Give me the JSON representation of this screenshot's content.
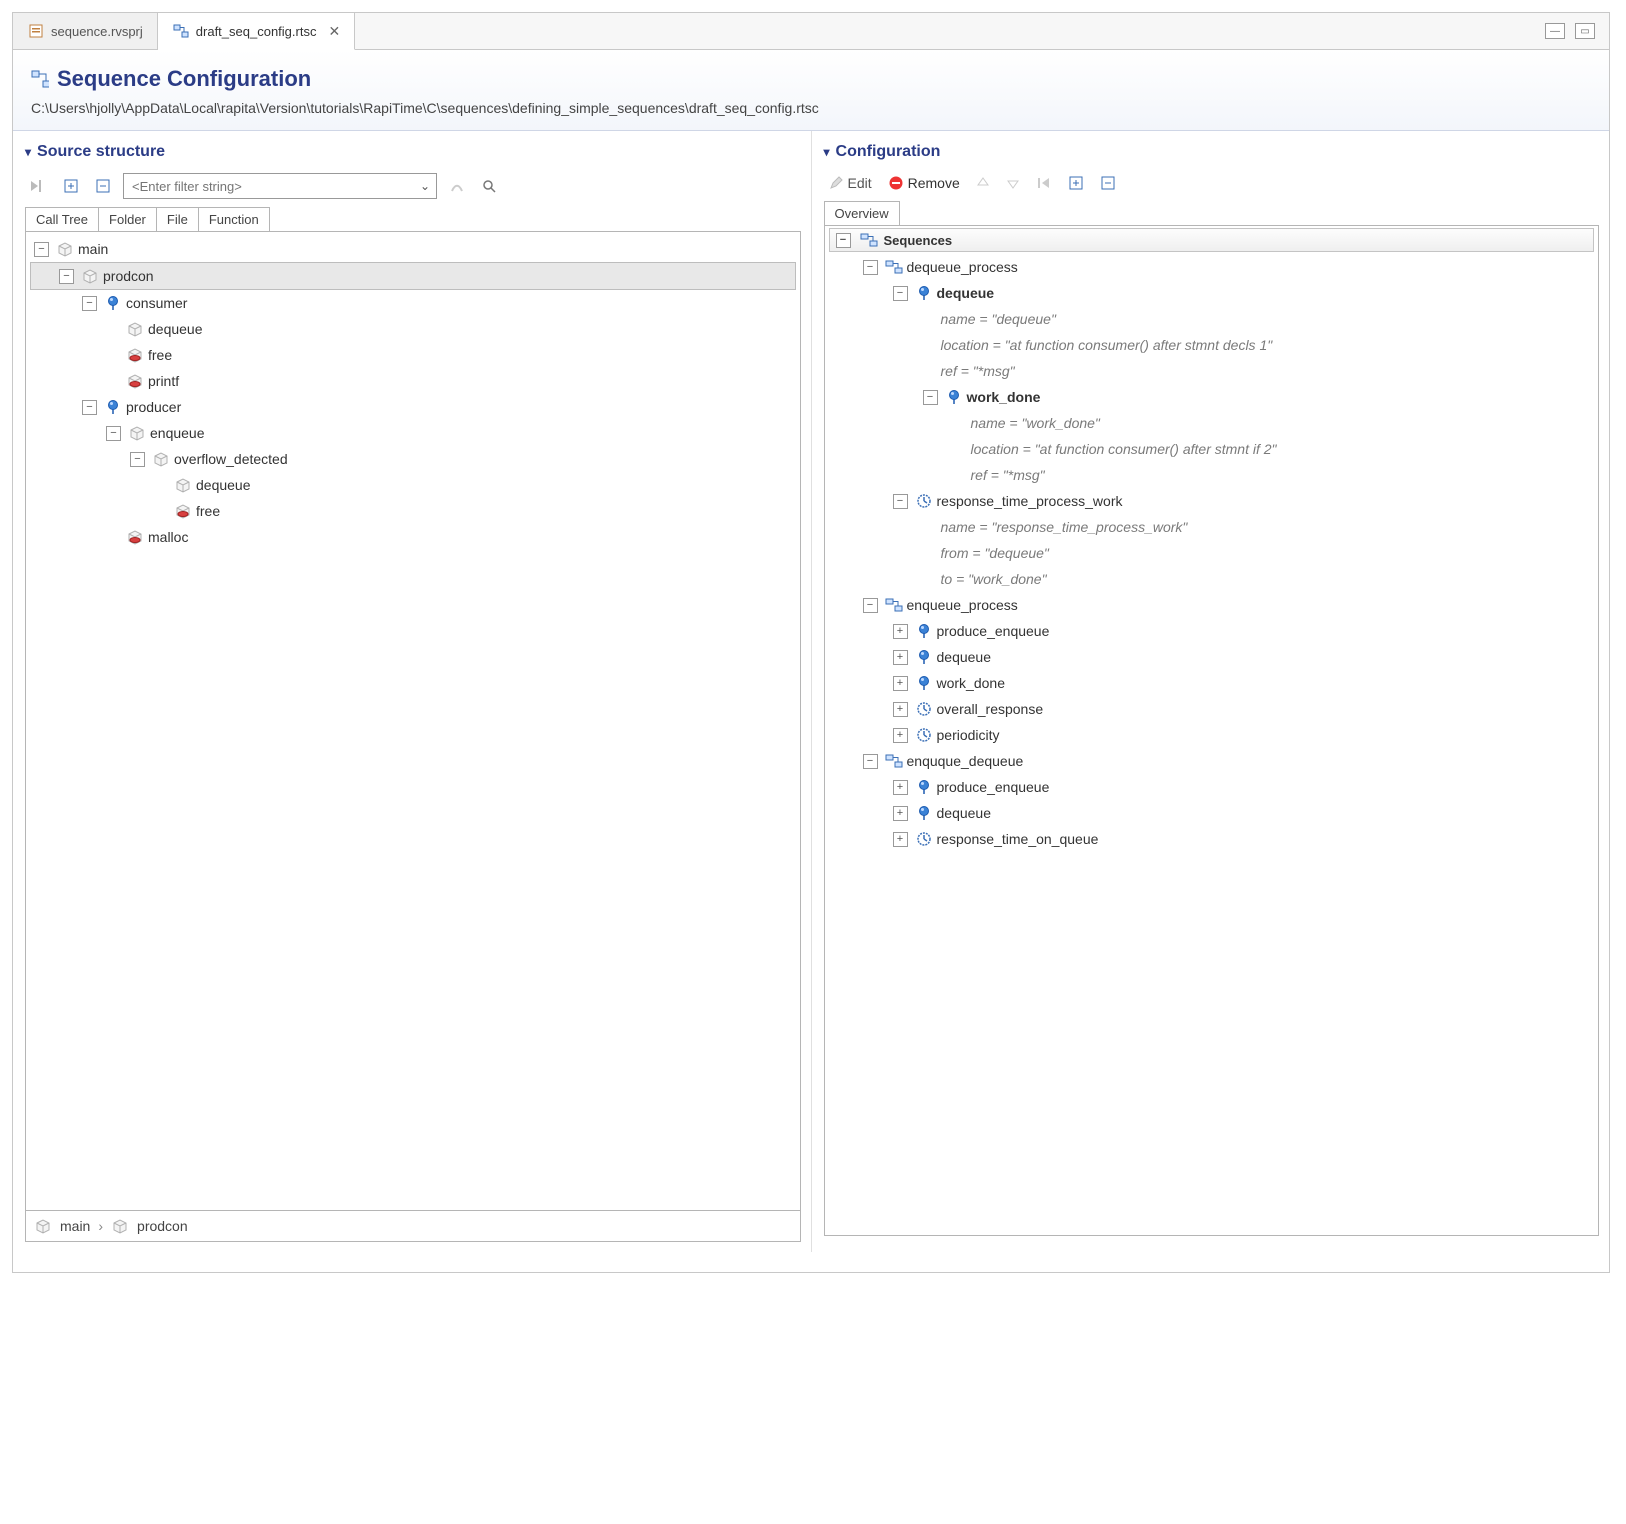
{
  "tabs": [
    {
      "label": "sequence.rvsprj",
      "icon": "file-project"
    },
    {
      "label": "draft_seq_config.rtsc",
      "icon": "sequence-config",
      "active": true
    }
  ],
  "editor": {
    "title": "Sequence Configuration",
    "path": "C:\\Users\\hjolly\\AppData\\Local\\rapita\\Version\\tutorials\\RapiTime\\C\\sequences\\defining_simple_sequences\\draft_seq_config.rtsc"
  },
  "panes": {
    "left": {
      "title": "Source structure",
      "filter_placeholder": "<Enter filter string>",
      "subtabs": [
        "Call Tree",
        "Folder",
        "File",
        "Function"
      ],
      "active_subtab": 0,
      "breadcrumb": [
        "main",
        "prodcon"
      ]
    },
    "right": {
      "title": "Configuration",
      "toolbar": {
        "edit": "Edit",
        "remove": "Remove"
      },
      "subtabs": [
        "Overview"
      ],
      "root_label": "Sequences"
    }
  },
  "source_tree": {
    "name": "main",
    "icon": "box",
    "children": [
      {
        "name": "prodcon",
        "icon": "box",
        "selected": true,
        "children": [
          {
            "name": "consumer",
            "icon": "pin",
            "children": [
              {
                "name": "dequeue",
                "icon": "box"
              },
              {
                "name": "free",
                "icon": "box-red"
              },
              {
                "name": "printf",
                "icon": "box-red"
              }
            ]
          },
          {
            "name": "producer",
            "icon": "pin",
            "children": [
              {
                "name": "enqueue",
                "icon": "box",
                "children": [
                  {
                    "name": "overflow_detected",
                    "icon": "box",
                    "children": [
                      {
                        "name": "dequeue",
                        "icon": "box"
                      },
                      {
                        "name": "free",
                        "icon": "box-red"
                      }
                    ]
                  }
                ]
              },
              {
                "name": "malloc",
                "icon": "box-red"
              }
            ]
          }
        ]
      }
    ]
  },
  "config_tree": [
    {
      "name": "dequeue_process",
      "icon": "seq",
      "children": [
        {
          "name": "dequeue",
          "icon": "pin",
          "bold": true,
          "props": [
            "name = \"dequeue\"",
            "location = \"at function consumer() after stmnt decls 1\"",
            "ref = \"*msg\""
          ],
          "children": [
            {
              "name": "work_done",
              "icon": "pin",
              "bold": true,
              "props": [
                "name = \"work_done\"",
                "location = \"at function consumer() after stmnt if 2\"",
                "ref = \"*msg\""
              ]
            }
          ]
        },
        {
          "name": "response_time_process_work",
          "icon": "clock",
          "props": [
            "name = \"response_time_process_work\"",
            "from = \"dequeue\"",
            "to = \"work_done\""
          ]
        }
      ]
    },
    {
      "name": "enqueue_process",
      "icon": "seq",
      "children": [
        {
          "name": "produce_enqueue",
          "icon": "pin",
          "collapsed": true
        },
        {
          "name": "dequeue",
          "icon": "pin",
          "collapsed": true
        },
        {
          "name": "work_done",
          "icon": "pin",
          "collapsed": true
        },
        {
          "name": "overall_response",
          "icon": "clock",
          "collapsed": true
        },
        {
          "name": "periodicity",
          "icon": "clock",
          "collapsed": true
        }
      ]
    },
    {
      "name": "enquque_dequeue",
      "icon": "seq",
      "children": [
        {
          "name": "produce_enqueue",
          "icon": "pin",
          "collapsed": true
        },
        {
          "name": "dequeue",
          "icon": "pin",
          "collapsed": true
        },
        {
          "name": "response_time_on_queue",
          "icon": "clock",
          "collapsed": true
        }
      ]
    }
  ]
}
